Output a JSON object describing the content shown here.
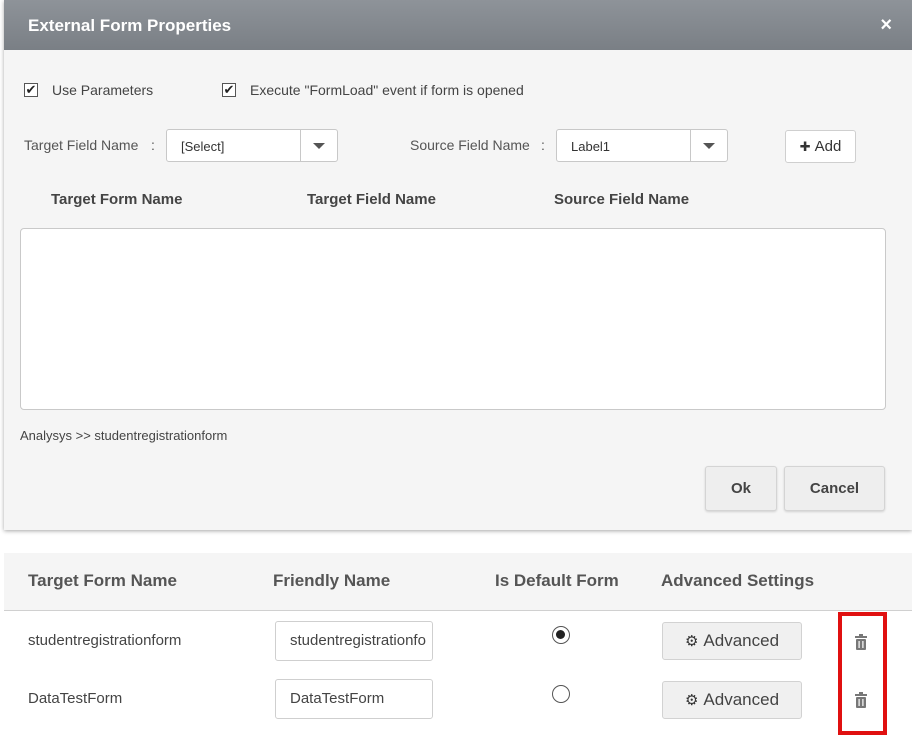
{
  "dialog": {
    "title": "External Form Properties",
    "close_icon": "×",
    "use_parameters_label": "Use Parameters",
    "use_parameters_checked": true,
    "execute_formload_label": "Execute \"FormLoad\" event if form is opened",
    "execute_formload_checked": true,
    "target_field_label": "Target Field Name",
    "target_field_value": "[Select]",
    "source_field_label": "Source Field Name",
    "source_field_value": "Label1",
    "colon": ":",
    "add_label": "Add",
    "add_icon": "✚",
    "columns": [
      "Target Form Name",
      "Target Field Name",
      "Source Field Name"
    ],
    "breadcrumb": "Analysys >> studentregistrationform",
    "ok_label": "Ok",
    "cancel_label": "Cancel"
  },
  "forms_table": {
    "columns": [
      "Target Form Name",
      "Friendly Name",
      "Is Default Form",
      "Advanced Settings"
    ],
    "rows": [
      {
        "target_form": "studentregistrationform",
        "friendly_name": "studentregistrationfo",
        "is_default": true,
        "advanced_label": "Advanced"
      },
      {
        "target_form": "DataTestForm",
        "friendly_name": "DataTestForm",
        "is_default": false,
        "advanced_label": "Advanced"
      }
    ],
    "delete_icon": "trash-icon",
    "advanced_icon": "gear-icon",
    "highlight_color": "#e01010"
  }
}
